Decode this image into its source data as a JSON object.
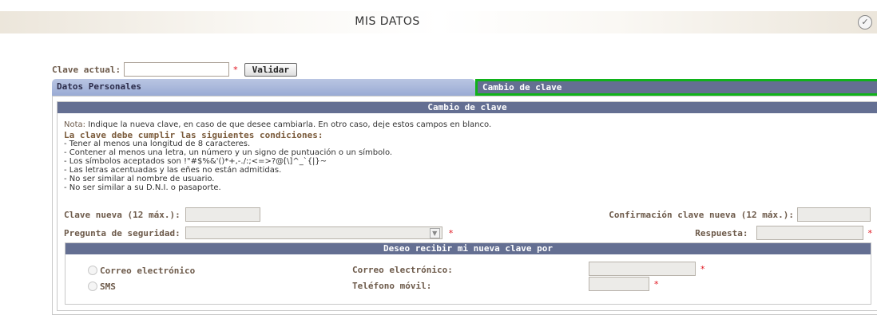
{
  "header": {
    "title": "MIS DATOS",
    "check_icon": "check-circle-icon"
  },
  "clave_actual": {
    "label": "Clave actual:",
    "required": "*",
    "validar_label": "Validar"
  },
  "tabs": [
    {
      "label": "Datos Personales",
      "active": false
    },
    {
      "label": "Cambio de clave",
      "active": true
    }
  ],
  "cambio": {
    "header": "Cambio de clave",
    "nota_label": "Nota:",
    "nota_text": "Indique la nueva clave, en caso de que desee cambiarla. En otro caso, deje estos campos en blanco.",
    "conditions_title": "La clave debe cumplir las siguientes condiciones:",
    "conditions": [
      "- Tener al menos una longitud de 8 caracteres.",
      "- Contener al menos una letra, un número y un signo de puntuación o un símbolo.",
      "- Los símbolos aceptados son !\"#$%&'()*+,-./:;<=>?@[\\]^_`{|}~",
      "- Las letras acentuadas y las eñes no están admitidas.",
      "- No ser similar al nombre de usuario.",
      "- No ser similar a su D.N.I. o pasaporte."
    ],
    "clave_nueva_label": "Clave nueva (12 máx.):",
    "confirmacion_label": "Confirmación clave nueva (12 máx.):",
    "pregunta_label": "Pregunta de seguridad:",
    "respuesta_label": "Respuesta:",
    "required": "*"
  },
  "deseo": {
    "header": "Deseo recibir mi nueva clave por",
    "options": [
      {
        "label": "Correo electrónico",
        "field_label": "Correo electrónico:"
      },
      {
        "label": "SMS",
        "field_label": "Teléfono móvil:"
      }
    ],
    "required": "*"
  }
}
